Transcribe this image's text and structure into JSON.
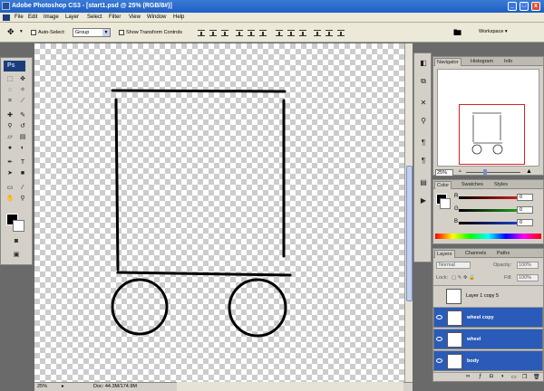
{
  "window": {
    "title": "Adobe Photoshop CS3 - [start1.psd @ 25% (RGB/8#)]",
    "minimize": "_",
    "restore": "□",
    "close": "x"
  },
  "menubar": {
    "items": [
      "File",
      "Edit",
      "Image",
      "Layer",
      "Select",
      "Filter",
      "View",
      "Window",
      "Help"
    ]
  },
  "options": {
    "auto_select_label": "Auto-Select:",
    "auto_select_value": "Group",
    "transform_label": "Show Transform Controls",
    "workspace_label": "Workspace ▾"
  },
  "toolbox": {
    "logo": "Ps"
  },
  "status": {
    "zoom": "25%",
    "doc": "Doc: 44.3M/174.9M"
  },
  "navigator": {
    "tabs": [
      "Navigator",
      "Histogram",
      "Info"
    ],
    "zoom": "25%"
  },
  "color": {
    "tabs": [
      "Color",
      "Swatches",
      "Styles"
    ],
    "channels": [
      {
        "label": "R",
        "value": "0",
        "color": "#d42020"
      },
      {
        "label": "G",
        "value": "0",
        "color": "#20a020"
      },
      {
        "label": "B",
        "value": "0",
        "color": "#2040d0"
      }
    ]
  },
  "layers": {
    "tabs": [
      "Layers",
      "Channels",
      "Paths"
    ],
    "blend_mode": "Normal",
    "opacity_label": "Opacity:",
    "opacity": "100%",
    "lock_label": "Lock:",
    "fill_label": "Fill:",
    "fill": "100%",
    "rows": [
      {
        "name": "Layer 1 copy 5",
        "selected": false
      },
      {
        "name": "wheel copy",
        "selected": true
      },
      {
        "name": "wheel",
        "selected": true
      },
      {
        "name": "body",
        "selected": true
      }
    ]
  }
}
